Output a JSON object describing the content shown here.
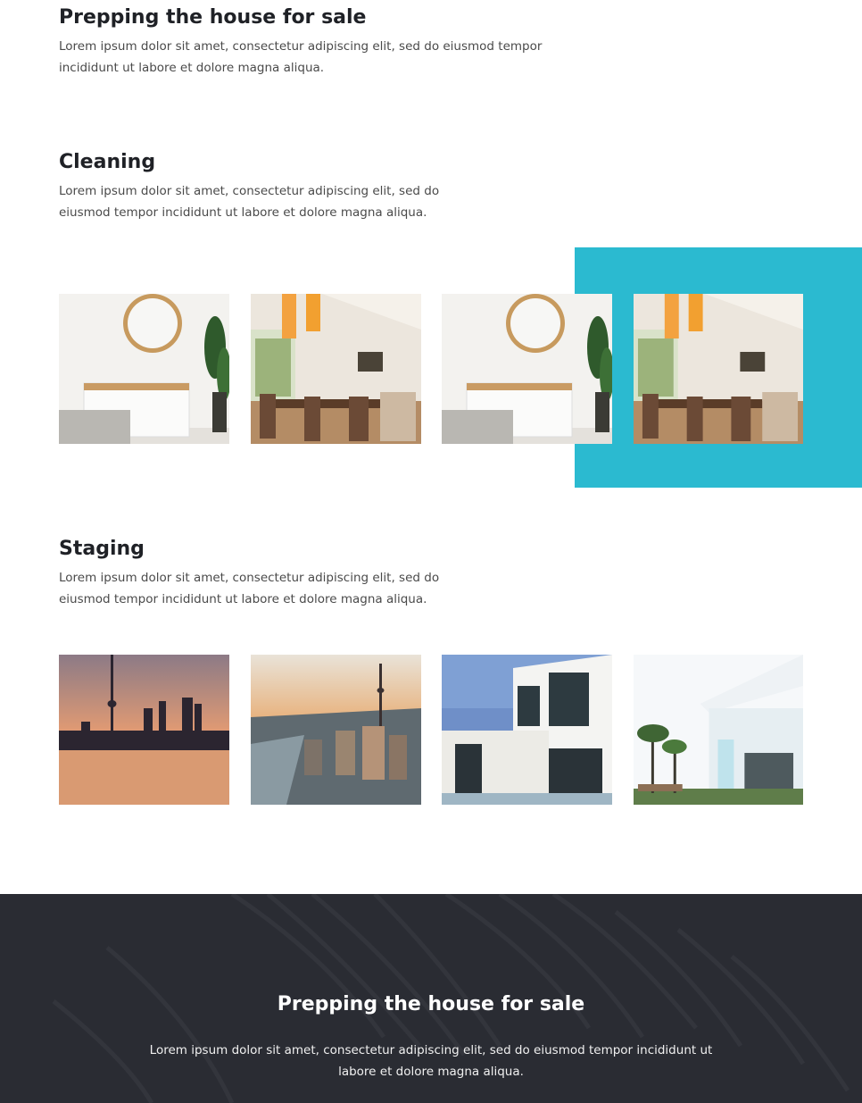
{
  "colors": {
    "accent": "#2bbad0",
    "dark_band": "#2a2c33",
    "heading": "#1f2126",
    "body_text": "#4a4a4a"
  },
  "intro": {
    "title": "Prepping the house for sale",
    "text": "Lorem ipsum dolor sit amet, consectetur adipiscing elit, sed do eiusmod tempor incididunt ut labore et dolore magna aliqua."
  },
  "cleaning": {
    "title": "Cleaning",
    "text": "Lorem ipsum dolor sit amet, consectetur adipiscing elit, sed do eiusmod tempor incididunt ut labore et dolore magna aliqua.",
    "images": [
      "mirror-console-photo",
      "dining-room-photo",
      "mirror-console-photo",
      "dining-room-photo"
    ]
  },
  "staging": {
    "title": "Staging",
    "text": "Lorem ipsum dolor sit amet, consectetur adipiscing elit, sed do eiusmod tempor incididunt ut labore et dolore magna aliqua.",
    "images": [
      "city-skyline-sunset-photo",
      "city-aerial-tower-photo",
      "modern-house-photo",
      "modern-villa-palms-photo"
    ]
  },
  "footer_band": {
    "title": "Prepping the house for sale",
    "text": "Lorem ipsum dolor sit amet, consectetur adipiscing elit, sed do eiusmod tempor incididunt ut labore et dolore magna aliqua."
  }
}
